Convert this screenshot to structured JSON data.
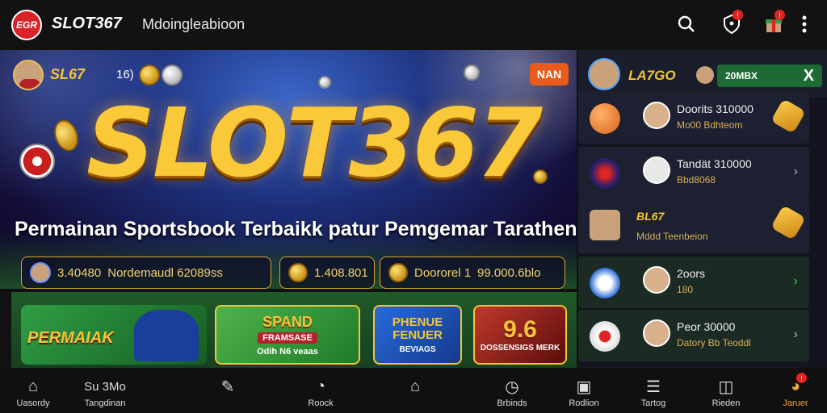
{
  "topbar": {
    "logo_text": "EGR",
    "brand": "SLOT367",
    "subtitle": "Mdoingleabioon",
    "notif_badge_1": "!",
    "notif_badge_2": "!"
  },
  "hero": {
    "mini_logo": "SL67",
    "number": "16)",
    "tag": "NAN",
    "title": "SLOT367",
    "tagline": "Permainan Sportsbook Terbaikk patur Pemgemar Tarathen",
    "stats": [
      {
        "value": "3.40480",
        "label": "Nordemaudl 62089ss"
      },
      {
        "value": "1.408.801"
      },
      {
        "value": "Doororel 1",
        "label": "99.000.6blo"
      }
    ]
  },
  "promos": [
    {
      "title": "PERMAIAK"
    },
    {
      "title": "SPAND",
      "subtitle": "FRAMSASE",
      "line": "Odih N6 veaas"
    },
    {
      "title": "PHENUE FENUER",
      "line": "BEVIAGS"
    },
    {
      "title": "9.6",
      "line": "DOSSENSIGS MERK"
    }
  ],
  "right_panel": {
    "logo": "LA7GO",
    "pill": "20MBX",
    "close_label": "X",
    "rows": [
      {
        "title": "Doorits 310000",
        "sub": "Mo00 Bdhteom"
      },
      {
        "title": "Tandät 310000",
        "sub": "Bbd8068"
      },
      {
        "title": "BL67",
        "sub": "Mddd Teenbeion"
      },
      {
        "title": "2oors",
        "sub": "180"
      },
      {
        "title": "Peor 30000",
        "sub": "Datory Bb Teoddl"
      }
    ]
  },
  "bottom_nav": [
    {
      "label": "Uasordy",
      "icon": "home-icon"
    },
    {
      "label": "Tangdinan",
      "top": "Su 3Mo",
      "icon": "clock-icon"
    },
    {
      "label": "",
      "icon": "pencil-icon"
    },
    {
      "label": "Roock",
      "icon": "timer-icon"
    },
    {
      "label": "",
      "icon": "house-icon"
    },
    {
      "label": "Brbinds",
      "icon": "stopwatch-icon"
    },
    {
      "label": "Rodlion",
      "icon": "card-icon"
    },
    {
      "label": "Tartog",
      "icon": "list-icon"
    },
    {
      "label": "Rieden",
      "icon": "device-icon"
    },
    {
      "label": "Jaruer",
      "icon": "clock-active-icon",
      "badge": "!"
    }
  ],
  "colors": {
    "accent": "#f3c53a",
    "badge": "#e02424",
    "green": "#1d6a34"
  }
}
